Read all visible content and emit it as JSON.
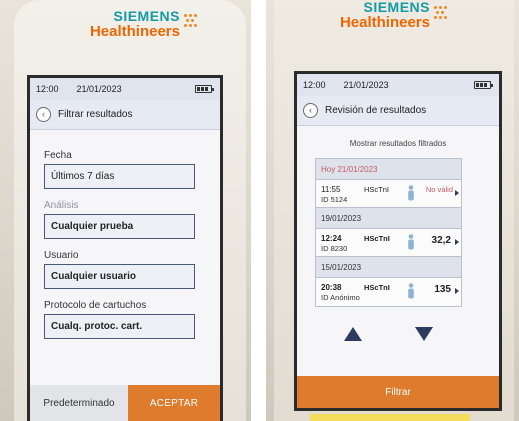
{
  "brand": {
    "name": "SIEMENS",
    "subname": "Healthineers"
  },
  "left_screen": {
    "status": {
      "time": "12:00",
      "date": "21/01/2023"
    },
    "title": "Filtrar resultados",
    "fields": [
      {
        "label": "Fecha",
        "value": "Últimos 7 días"
      },
      {
        "label": "Análisis",
        "value": "Cualquier prueba"
      },
      {
        "label": "Usuario",
        "value": "Cualquier usuario"
      },
      {
        "label": "Protocolo de cartuchos",
        "value": "Cualq. protoc. cart."
      }
    ],
    "buttons": {
      "default": "Predeterminado",
      "accept": "ACEPTAR"
    }
  },
  "right_screen": {
    "status": {
      "time": "12:00",
      "date": "21/01/2023"
    },
    "title": "Revisión de resultados",
    "subtitle": "Mostrar resultados filtrados",
    "groups": [
      {
        "header": "Hoy  21/01/2023",
        "rows": [
          {
            "time": "11:55",
            "id": "ID 5124",
            "test": "HScTnI",
            "value": "No válid"
          }
        ]
      },
      {
        "header": "19/01/2023",
        "rows": [
          {
            "time": "12:24",
            "id": "ID 8230",
            "test": "HScTnI",
            "value": "32,2"
          }
        ]
      },
      {
        "header": "15/01/2023",
        "rows": [
          {
            "time": "20:38",
            "id": "ID Anónimo",
            "test": "HScTnI",
            "value": "135"
          }
        ]
      }
    ],
    "filter_button": "Filtrar"
  },
  "colors": {
    "accent_orange": "#de7b2c",
    "brand_teal": "#159ba6",
    "invalid_red": "#c75a66",
    "navy": "#2d3b5e"
  }
}
